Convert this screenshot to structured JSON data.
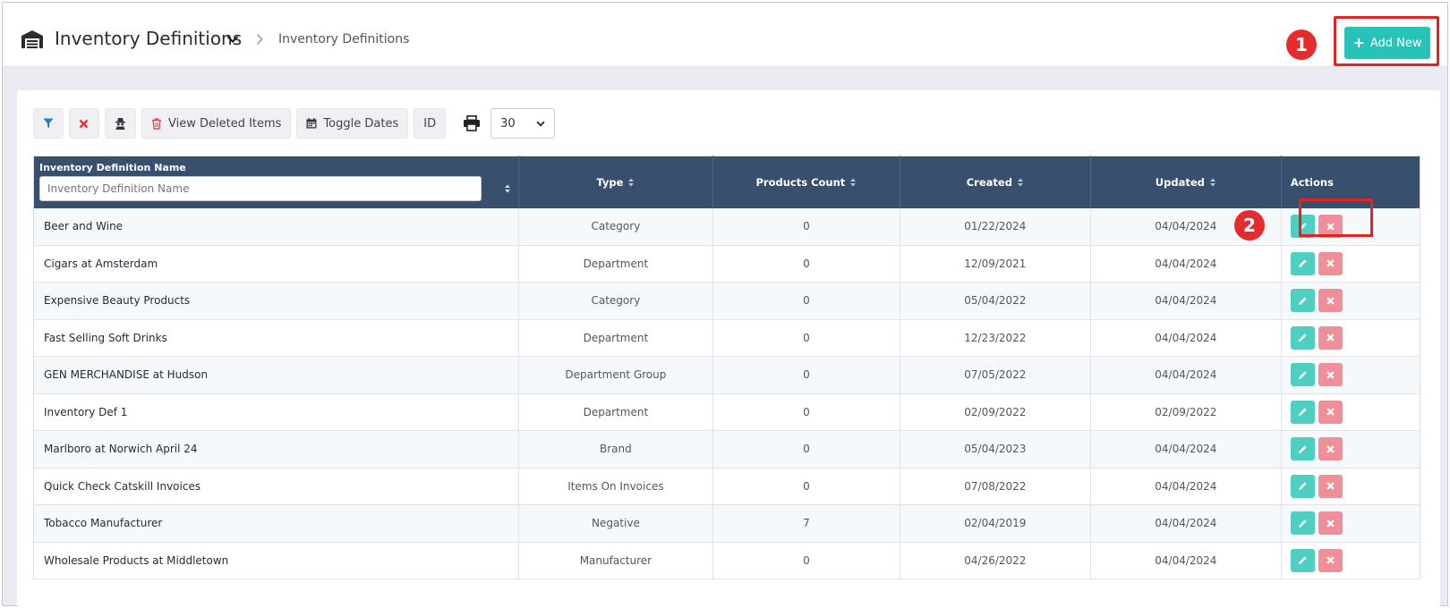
{
  "header": {
    "title": "Inventory Definitions",
    "breadcrumb": "Inventory Definitions",
    "add_new_label": "Add New"
  },
  "annotations": [
    "1",
    "2"
  ],
  "toolbar": {
    "view_deleted_label": "View Deleted Items",
    "toggle_dates_label": "Toggle Dates",
    "id_label": "ID",
    "page_size": "30"
  },
  "table": {
    "columns": {
      "name": "Inventory Definition Name",
      "type": "Type",
      "products_count": "Products Count",
      "created": "Created",
      "updated": "Updated",
      "actions": "Actions"
    },
    "name_filter_placeholder": "Inventory Definition Name",
    "rows": [
      {
        "name": "Beer and Wine",
        "type": "Category",
        "count": "0",
        "created": "01/22/2024",
        "updated": "04/04/2024"
      },
      {
        "name": "Cigars at Amsterdam",
        "type": "Department",
        "count": "0",
        "created": "12/09/2021",
        "updated": "04/04/2024"
      },
      {
        "name": "Expensive Beauty Products",
        "type": "Category",
        "count": "0",
        "created": "05/04/2022",
        "updated": "04/04/2024"
      },
      {
        "name": "Fast Selling Soft Drinks",
        "type": "Department",
        "count": "0",
        "created": "12/23/2022",
        "updated": "04/04/2024"
      },
      {
        "name": "GEN MERCHANDISE at Hudson",
        "type": "Department Group",
        "count": "0",
        "created": "07/05/2022",
        "updated": "04/04/2024"
      },
      {
        "name": "Inventory Def 1",
        "type": "Department",
        "count": "0",
        "created": "02/09/2022",
        "updated": "02/09/2022"
      },
      {
        "name": "Marlboro at Norwich April 24",
        "type": "Brand",
        "count": "0",
        "created": "05/04/2023",
        "updated": "04/04/2024"
      },
      {
        "name": "Quick Check Catskill Invoices",
        "type": "Items On Invoices",
        "count": "0",
        "created": "07/08/2022",
        "updated": "04/04/2024"
      },
      {
        "name": "Tobacco Manufacturer",
        "type": "Negative",
        "count": "7",
        "created": "02/04/2019",
        "updated": "04/04/2024"
      },
      {
        "name": "Wholesale Products at Middletown",
        "type": "Manufacturer",
        "count": "0",
        "created": "04/26/2022",
        "updated": "04/04/2024"
      }
    ]
  },
  "colors": {
    "accent": "#27c3b6",
    "table_header": "#384f6d",
    "delete": "#ef8f9a",
    "highlight": "#e02424"
  }
}
